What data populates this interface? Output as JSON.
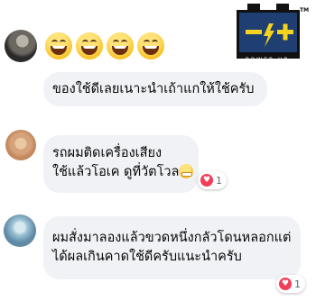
{
  "comments": [
    {
      "id": "c1",
      "text": "ของใช้ดีเลยเนาะนำเถ้าแกให้ใช้ครับ",
      "emojis": [
        "grinning-face",
        "grinning-face",
        "grinning-face",
        "grinning-face"
      ]
    },
    {
      "id": "c2",
      "lines": [
        "รถผมติดเครื่องเสียง",
        "ใช้แล้วโอเค ดูที่วัตโวล"
      ],
      "reaction": {
        "icon": "heart",
        "count": "1"
      }
    },
    {
      "id": "c3",
      "lines": [
        "ผมสั่งมาลองแล้วขวดหนึ่งกลัวโดนหลอกแต่",
        "ได้ผลเกินคาดใช้ดีครับแนะนำครับ"
      ],
      "reaction": {
        "icon": "heart",
        "count": "1"
      }
    }
  ],
  "logo": {
    "brand_text": "POWER UP",
    "trademark": "TM",
    "colors": {
      "navy": "#1f3f72",
      "yellow": "#f4d41e",
      "black": "#111111"
    }
  },
  "colors": {
    "bubble": "#f0f2f5",
    "text": "#050505",
    "heart": "#f33e58"
  }
}
